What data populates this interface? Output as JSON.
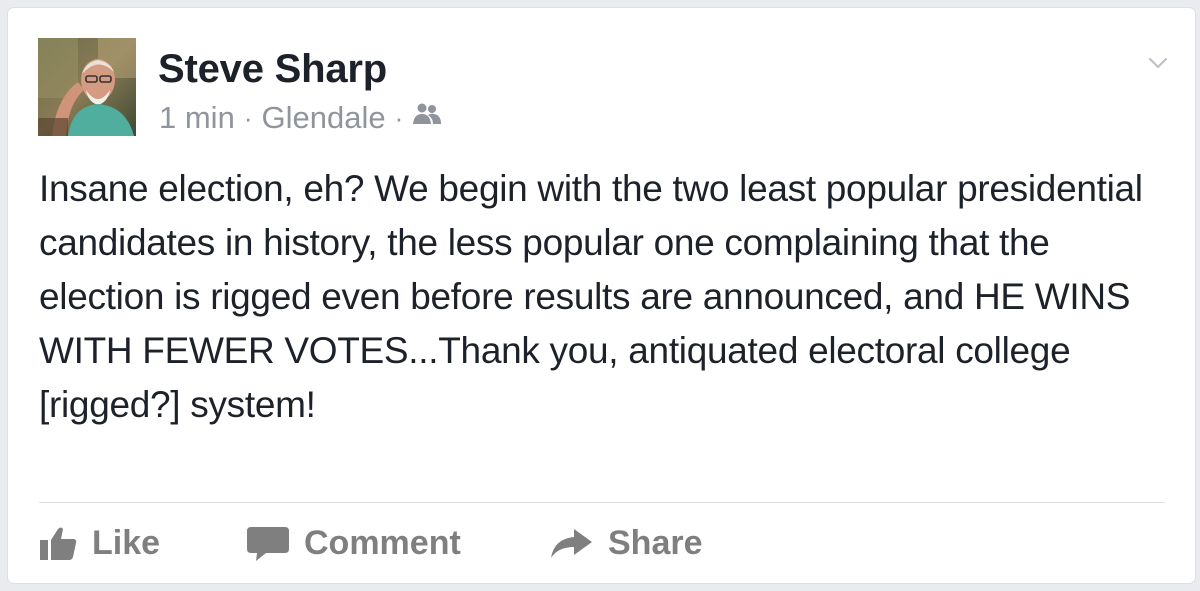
{
  "post": {
    "author": "Steve Sharp",
    "time": "1 min",
    "separator": "·",
    "location": "Glendale",
    "audience_icon": "friends-icon",
    "text": "Insane election, eh? We begin with the two least popular presidential candidates in history, the less popular one complaining that the election is rigged even before results are announced, and HE WINS WITH FEWER VOTES...Thank you, antiquated electoral college [rigged?] system!"
  },
  "actions": {
    "like_label": "Like",
    "comment_label": "Comment",
    "share_label": "Share"
  },
  "colors": {
    "background": "#e9ebee",
    "card": "#ffffff",
    "text": "#1d2129",
    "meta": "#90949c",
    "action": "#7f7f7f"
  }
}
